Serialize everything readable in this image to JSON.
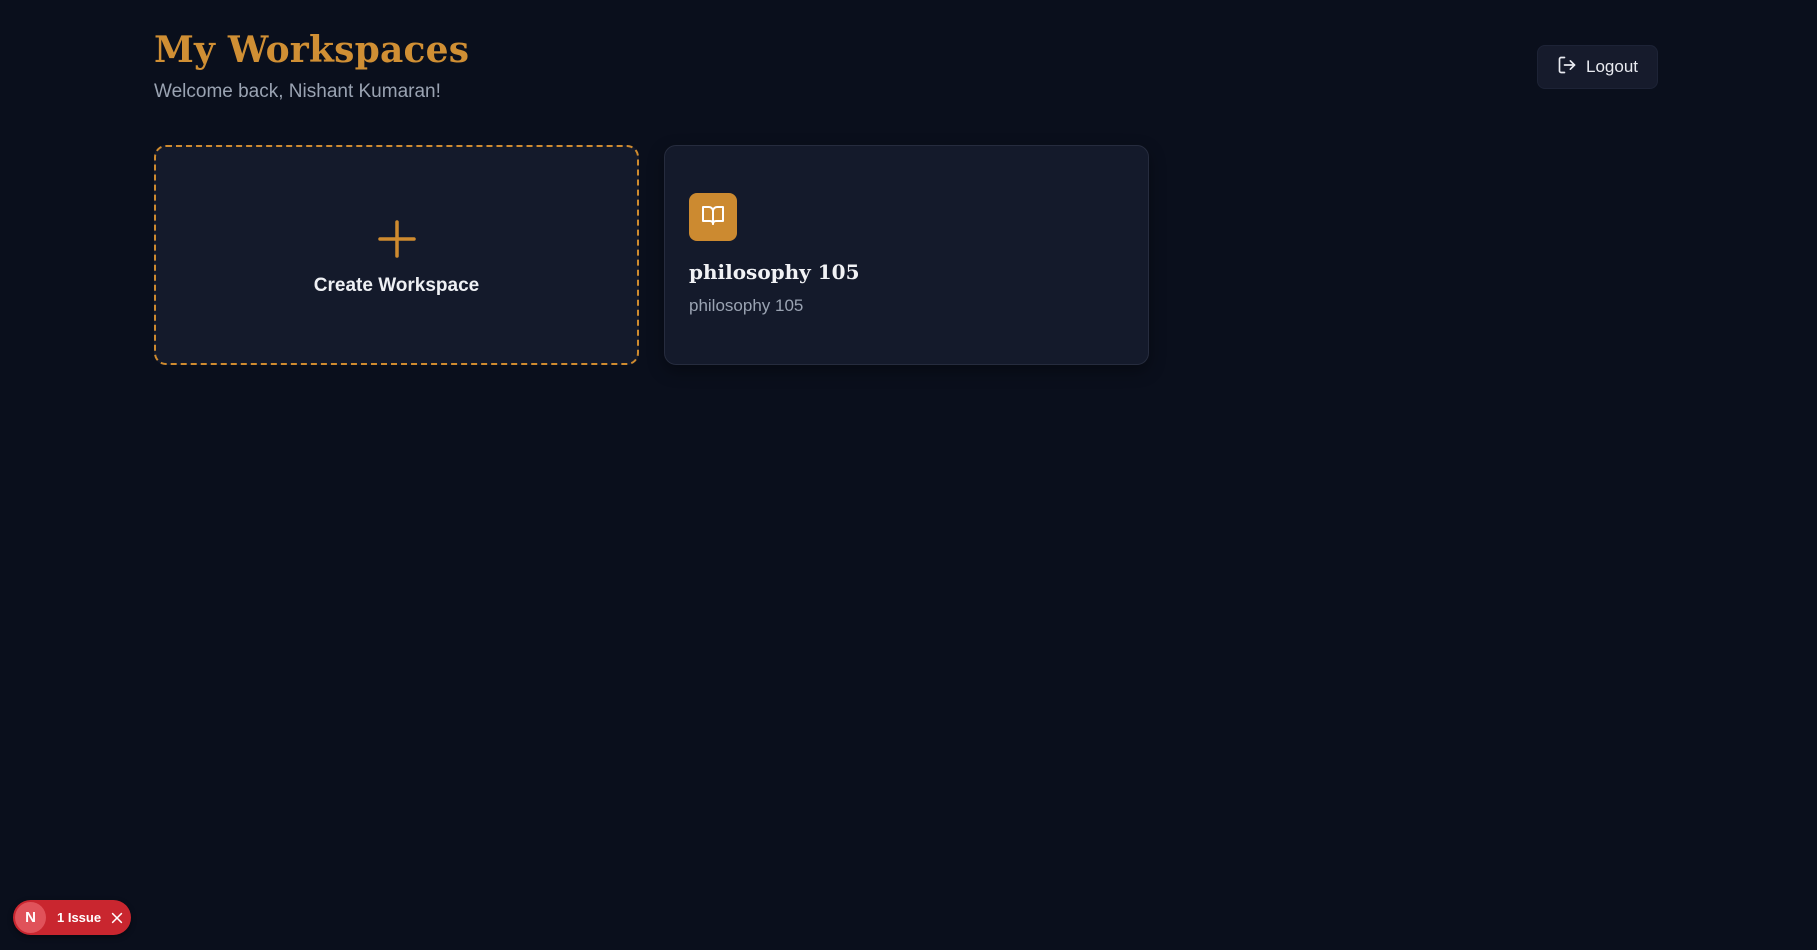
{
  "header": {
    "title": "My Workspaces",
    "subtitle": "Welcome back, Nishant Kumaran!"
  },
  "logout": {
    "label": "Logout",
    "icon": "logout-icon"
  },
  "create_card": {
    "label": "Create Workspace",
    "icon": "plus-icon"
  },
  "workspaces": [
    {
      "title": "philosophy 105",
      "description": "philosophy 105",
      "icon": "book-open-icon"
    }
  ],
  "issue_badge": {
    "logo_letter": "N",
    "label": "1 Issue",
    "close_icon": "close-icon"
  },
  "colors": {
    "background": "#0a0f1c",
    "accent": "#d08f34",
    "card": "#141a2b",
    "issue": "#c9262f"
  }
}
